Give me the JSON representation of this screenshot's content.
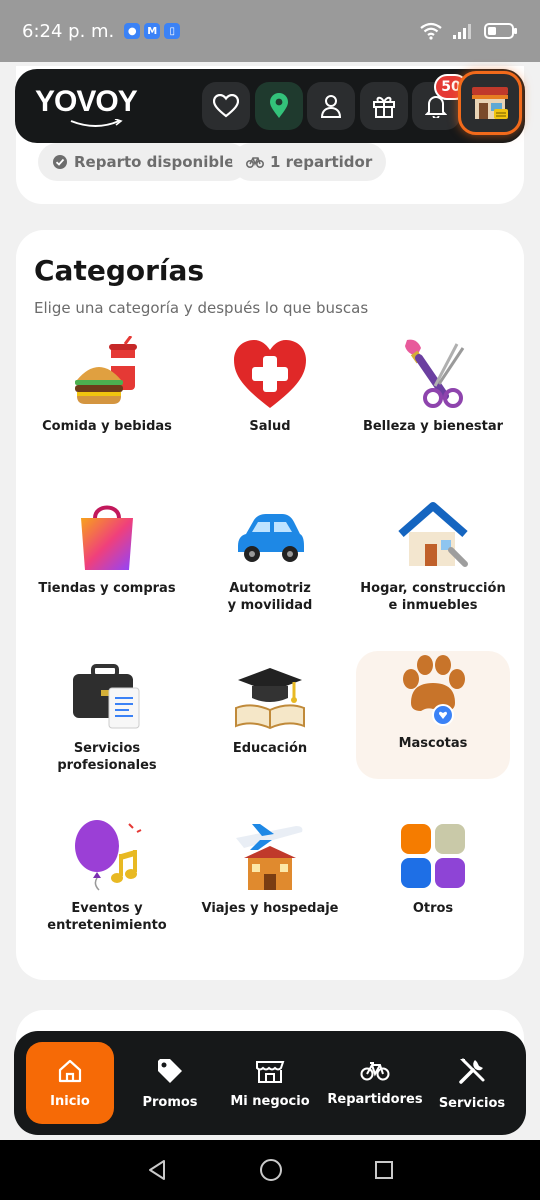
{
  "status_bar": {
    "time": "6:24 p. m.",
    "notifications": [
      "chat-icon",
      "mail-icon",
      "phone-icon"
    ]
  },
  "header": {
    "brand": "YOVOY",
    "notification_count": "50",
    "buttons": [
      "heart-icon",
      "location-pin-icon",
      "user-icon",
      "gift-icon",
      "bell-icon"
    ]
  },
  "top_card": {
    "chips": {
      "delivery": "Reparto disponible",
      "riders": "1 repartidor"
    }
  },
  "categories": {
    "title": "Categorías",
    "subtitle": "Elige una categoría y después lo que buscas",
    "items": [
      {
        "label": "Comida y bebidas",
        "icon": "burger-drink-icon"
      },
      {
        "label": "Salud",
        "icon": "heart-cross-icon"
      },
      {
        "label": "Belleza y bienestar",
        "icon": "brush-scissors-icon"
      },
      {
        "label": "Tiendas y compras",
        "icon": "shopping-bag-icon"
      },
      {
        "label": "Automotriz\ny movilidad",
        "icon": "car-icon"
      },
      {
        "label": "Hogar, construcción\ne inmuebles",
        "icon": "house-icon"
      },
      {
        "label": "Servicios\nprofesionales",
        "icon": "briefcase-icon"
      },
      {
        "label": "Educación",
        "icon": "graduation-book-icon"
      },
      {
        "label": "Mascotas",
        "icon": "paw-icon"
      },
      {
        "label": "Eventos y\nentretenimiento",
        "icon": "balloon-music-icon"
      },
      {
        "label": "Viajes y hospedaje",
        "icon": "plane-hotel-icon"
      },
      {
        "label": "Otros",
        "icon": "grid-blocks-icon"
      }
    ]
  },
  "bottom_nav": {
    "items": [
      {
        "label": "Inicio",
        "icon": "home-icon",
        "active": true
      },
      {
        "label": "Promos",
        "icon": "tag-icon"
      },
      {
        "label": "Mi negocio",
        "icon": "storefront-icon"
      },
      {
        "label": "Repartidores",
        "icon": "bicycle-icon"
      },
      {
        "label": "Servicios",
        "icon": "tools-icon"
      }
    ]
  },
  "colors": {
    "accent": "#f66a06",
    "header_bg": "#161819",
    "badge": "#e53935"
  }
}
